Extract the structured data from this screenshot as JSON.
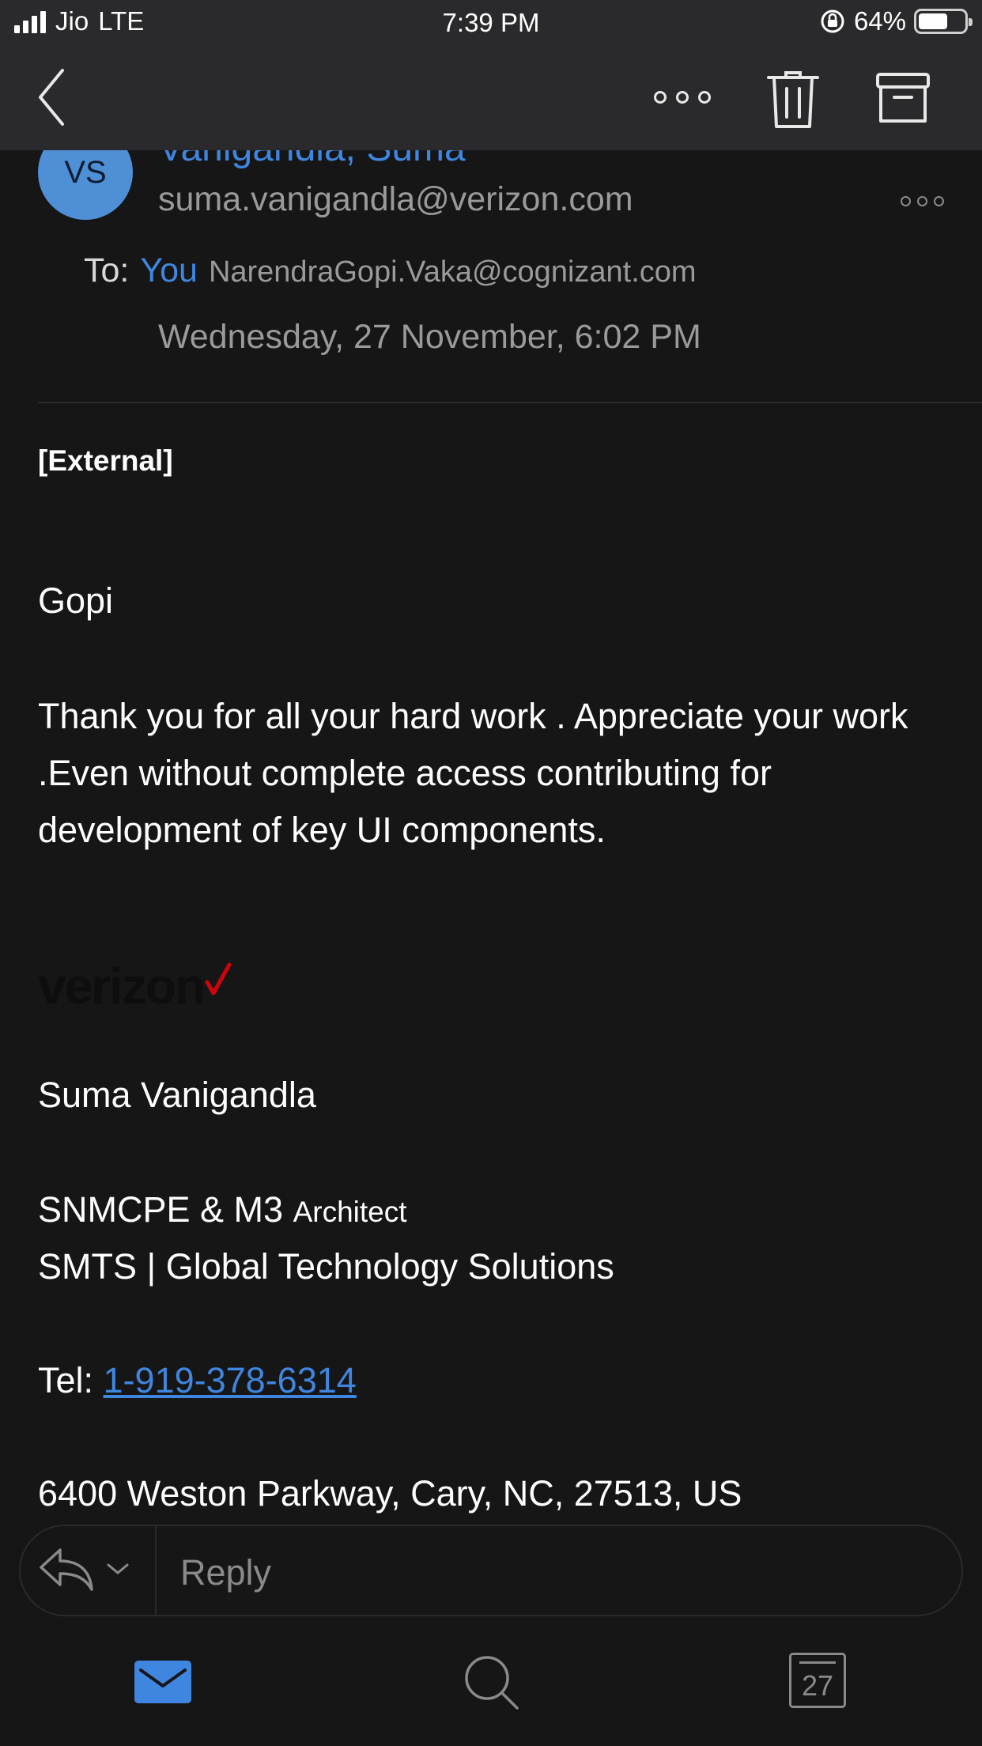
{
  "status_bar": {
    "carrier": "Jio",
    "network": "LTE",
    "time": "7:39 PM",
    "battery": "64%",
    "battery_level": 0.64
  },
  "toolbar": {
    "back_icon": "chevron-left-icon",
    "more_icon": "ellipsis-icon",
    "delete_icon": "trash-icon",
    "archive_icon": "archive-icon"
  },
  "message": {
    "avatar_initials": "VS",
    "sender_name": "Vanigandla, Suma",
    "sender_email": "suma.vanigandla@verizon.com",
    "to_label": "To:",
    "to_name": "You",
    "to_email": "NarendraGopi.Vaka@cognizant.com",
    "date": "Wednesday, 27 November, 6:02 PM"
  },
  "body": {
    "external_tag": "[External]",
    "greeting": "Gopi",
    "paragraph": "Thank you for all your hard work . Appreciate your work .Even without complete access contributing for development of key UI components.",
    "logo_text": "verizon",
    "logo_check": "✓",
    "signature_name": "Suma Vanigandla",
    "title_main": "SNMCPE & M3 ",
    "title_small": "Architect",
    "title_line2": "SMTS | Global Technology Solutions",
    "tel_label": "Tel: ",
    "tel_number": "1-919-378-6314",
    "address": "6400 Weston Parkway, Cary, NC, 27513, US"
  },
  "reply": {
    "placeholder": "Reply"
  },
  "tab_bar": {
    "calendar_day": "27"
  },
  "colors": {
    "accent": "#3f86e0",
    "background": "#161616",
    "bar": "#2a2a2c",
    "verizon_red": "#cd040b"
  }
}
